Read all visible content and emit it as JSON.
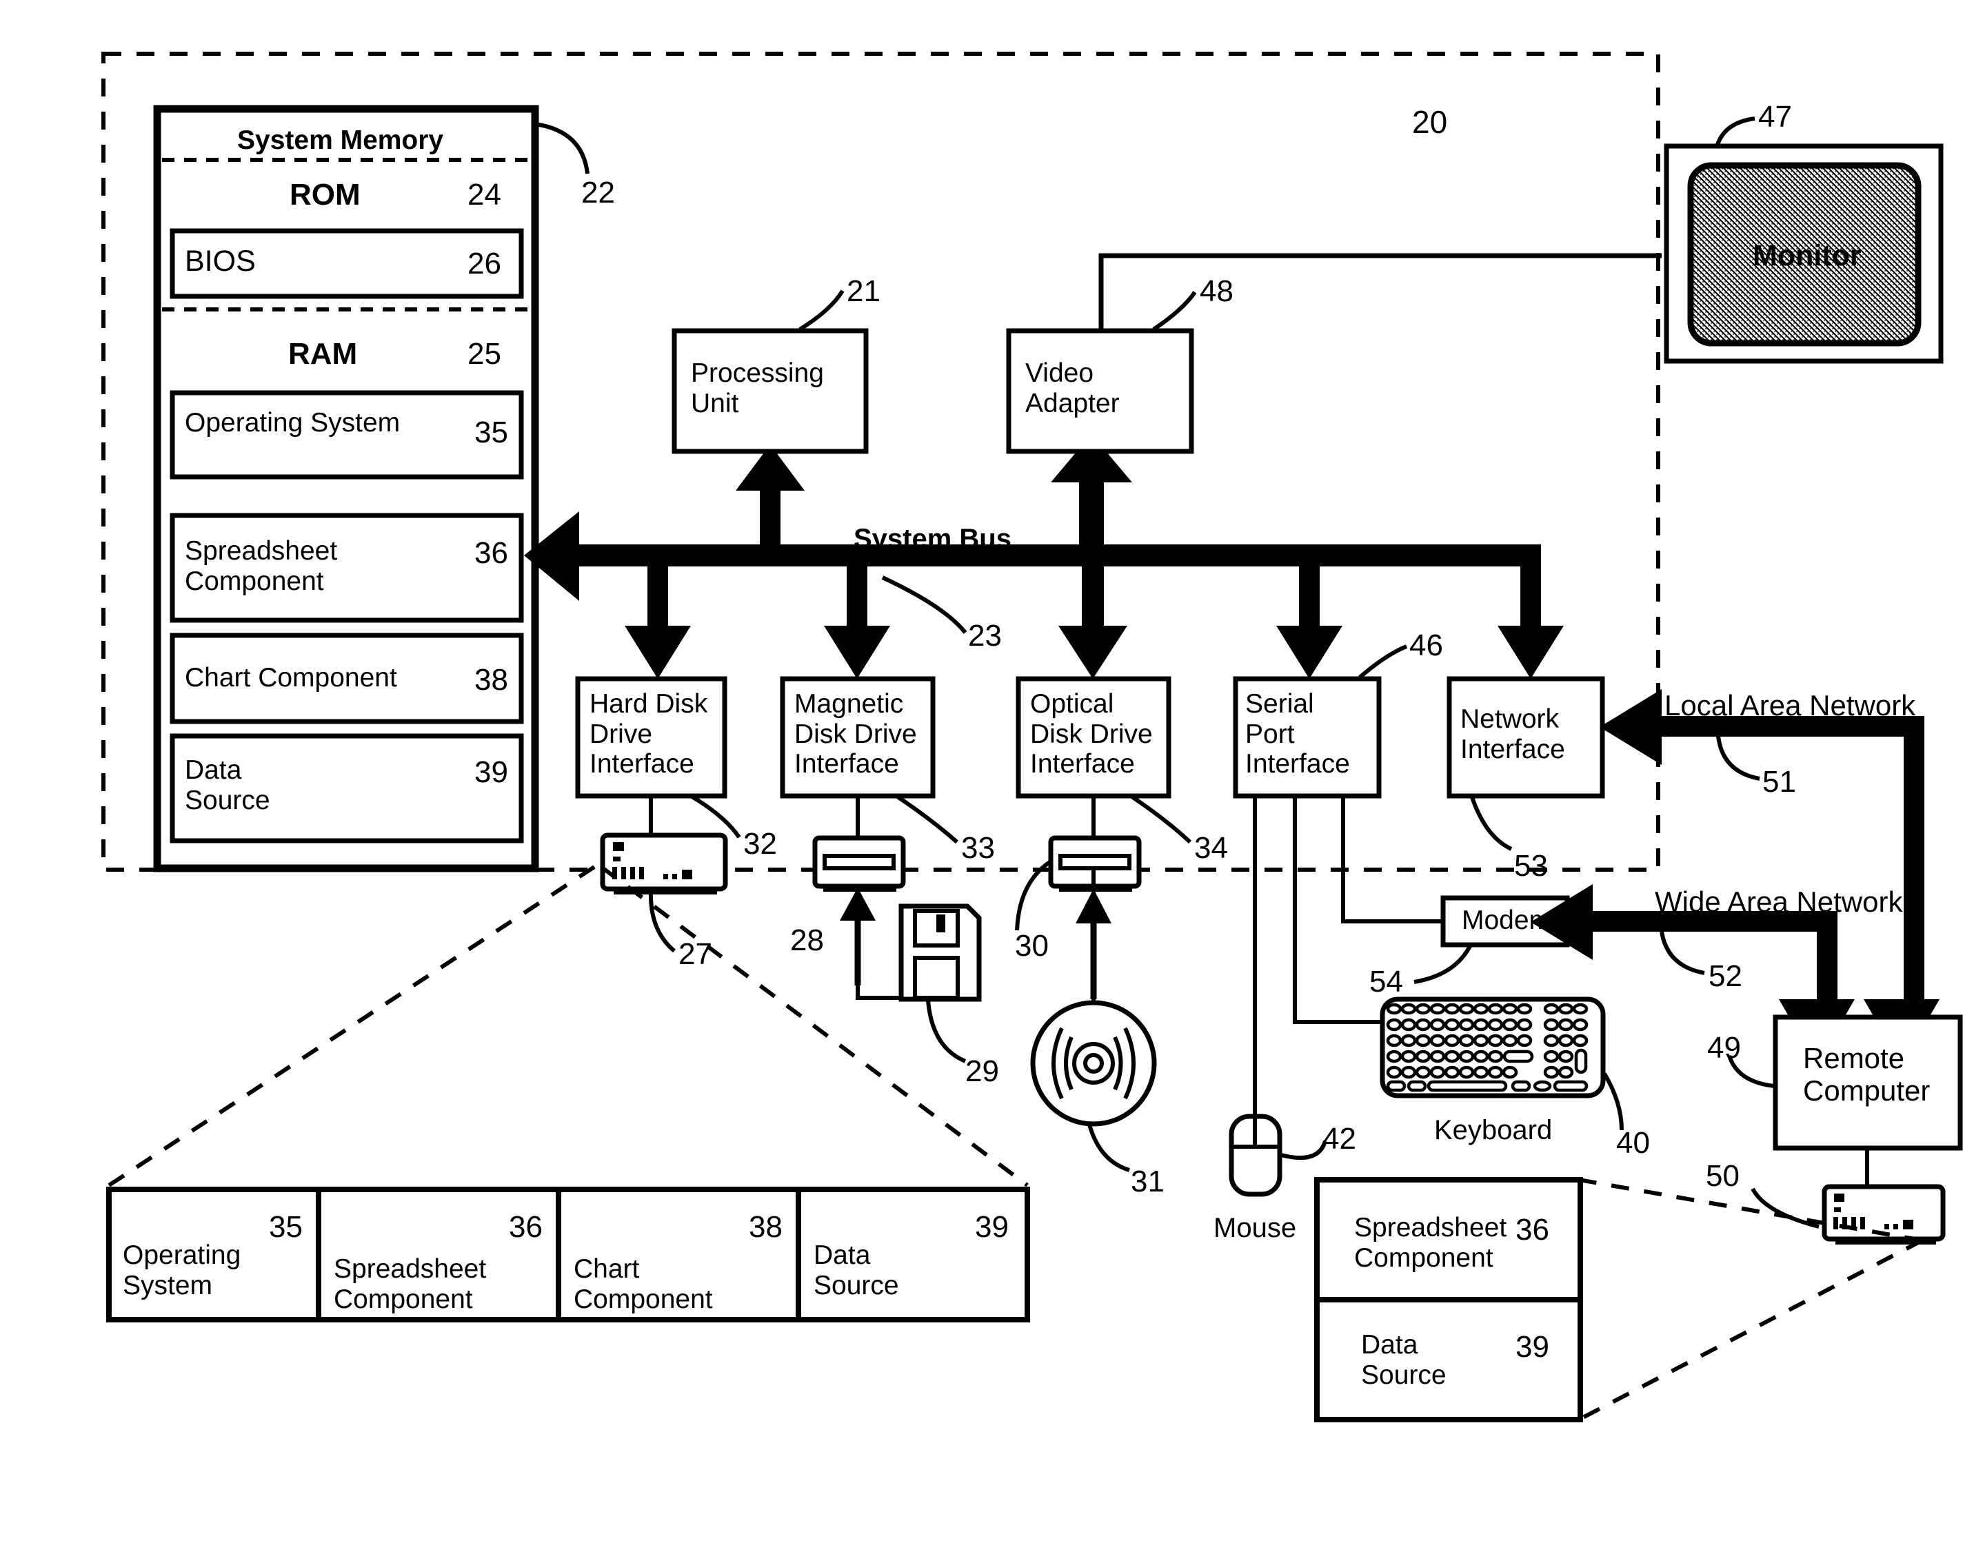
{
  "figure": {
    "outer_ref": "20",
    "system_memory": {
      "title": "System Memory",
      "ref": "22",
      "rom": {
        "label": "ROM",
        "ref": "24"
      },
      "bios": {
        "label": "BIOS",
        "ref": "26"
      },
      "ram": {
        "label": "RAM",
        "ref": "25"
      },
      "ram_items": [
        {
          "label": "Operating System",
          "ref": "35"
        },
        {
          "label": "Spreadsheet\nComponent",
          "ref": "36"
        },
        {
          "label": "Chart Component",
          "ref": "38"
        },
        {
          "label": "Data\nSource",
          "ref": "39"
        }
      ]
    },
    "processing_unit": {
      "label": "Processing\nUnit",
      "ref": "21"
    },
    "video_adapter": {
      "label": "Video\nAdapter",
      "ref": "48"
    },
    "monitor": {
      "label": "Monitor",
      "ref": "47"
    },
    "system_bus": {
      "label": "System Bus",
      "ref": "23"
    },
    "interfaces": [
      {
        "label": "Hard Disk\nDrive\nInterface",
        "ref": "32"
      },
      {
        "label": "Magnetic\nDisk Drive\nInterface",
        "ref": "33"
      },
      {
        "label": "Optical\nDisk Drive\nInterface",
        "ref": "34"
      },
      {
        "label": "Serial\nPort\nInterface",
        "ref": "46"
      },
      {
        "label": "Network\nInterface",
        "ref": "53"
      }
    ],
    "drives": [
      {
        "name": "hard-disk-drive",
        "ref": "27"
      },
      {
        "name": "magnetic-disk-drive",
        "ref": "28"
      },
      {
        "name": "optical-disk-drive",
        "ref": "30"
      }
    ],
    "media": [
      {
        "name": "floppy-disk",
        "ref": "29"
      },
      {
        "name": "optical-disc",
        "ref": "31"
      }
    ],
    "peripherals": {
      "mouse": {
        "label": "Mouse",
        "ref": "42"
      },
      "keyboard": {
        "label": "Keyboard",
        "ref": "40"
      },
      "modem": {
        "label": "Modem",
        "ref": "54"
      }
    },
    "networks": {
      "lan": {
        "label": "Local Area Network",
        "ref": "51"
      },
      "wan": {
        "label": "Wide Area Network",
        "ref": "52"
      }
    },
    "remote_computer": {
      "label": "Remote\nComputer",
      "ref": "49"
    },
    "remote_drive": {
      "ref": "50"
    },
    "hard_disk_contents": [
      {
        "label": "Operating\nSystem",
        "ref": "35"
      },
      {
        "label": "Spreadsheet\nComponent",
        "ref": "36"
      },
      {
        "label": "Chart\nComponent",
        "ref": "38"
      },
      {
        "label": "Data\nSource",
        "ref": "39"
      }
    ],
    "remote_disk_contents": [
      {
        "label": "Spreadsheet\nComponent",
        "ref": "36"
      },
      {
        "label": "Data\nSource",
        "ref": "39"
      }
    ]
  },
  "colors": {
    "ink": "#000000",
    "paper": "#ffffff",
    "screen_fill": "#9a9a9a"
  }
}
